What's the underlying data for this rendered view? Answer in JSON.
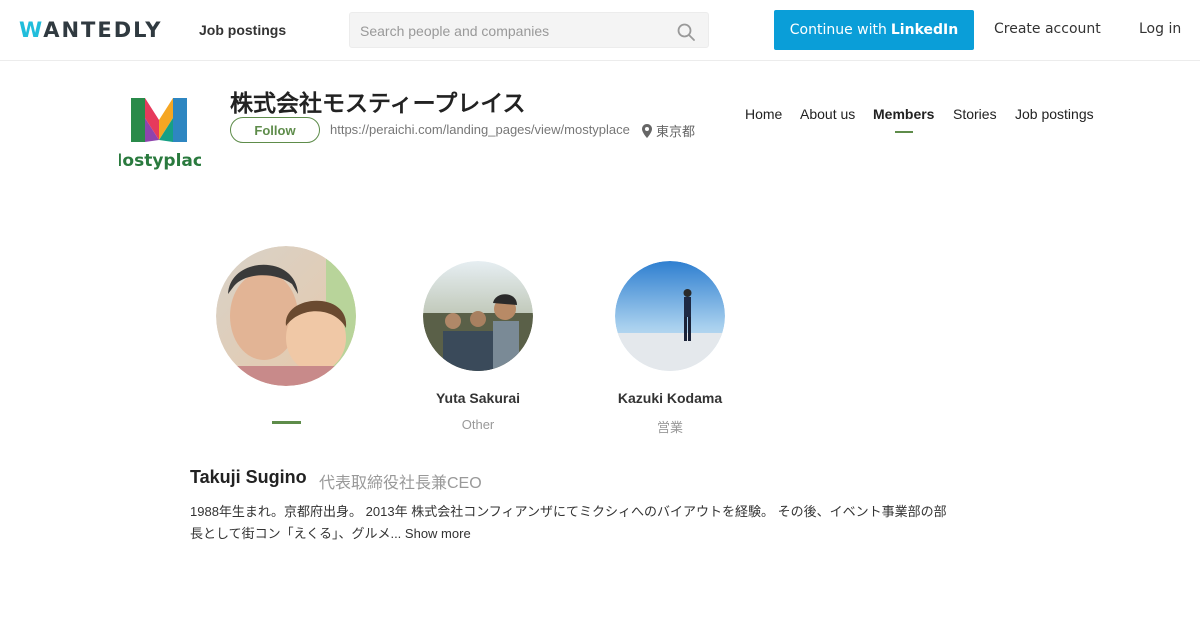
{
  "header": {
    "logo_first": "W",
    "logo_rest": "ANTEDLY",
    "nav_jobs": "Job postings",
    "search_placeholder": "Search people and companies",
    "linkedin_prefix": "Continue with",
    "linkedin_brand": "LinkedIn",
    "create_account": "Create account",
    "login": "Log in"
  },
  "company": {
    "name": "株式会社モスティープレイス",
    "logo_text": "Mostyplace",
    "follow_label": "Follow",
    "url": "https://peraichi.com/landing_pages/view/mostyplace",
    "location": "東京都",
    "tabs": [
      {
        "label": "Home",
        "active": false
      },
      {
        "label": "About us",
        "active": false
      },
      {
        "label": "Members",
        "active": true
      },
      {
        "label": "Stories",
        "active": false
      },
      {
        "label": "Job postings",
        "active": false
      }
    ]
  },
  "members": [
    {
      "name": "",
      "role": "",
      "selected": true
    },
    {
      "name": "Yuta Sakurai",
      "role": "Other",
      "selected": false
    },
    {
      "name": "Kazuki Kodama",
      "role": "営業",
      "selected": false
    }
  ],
  "profile": {
    "name": "Takuji Sugino",
    "title": "代表取締役社長兼CEO",
    "bio": "1988年生まれ。京都府出身。 2013年 株式会社コンフィアンザにてミクシィへのバイアウトを経験。 その後、イベント事業部の部長として街コン「えくる」、グルメ...",
    "show_more": "Show more"
  },
  "colors": {
    "brand_blue": "#0a9ed8",
    "accent_green": "#5e8c4a",
    "logo_cyan": "#21bddb"
  }
}
